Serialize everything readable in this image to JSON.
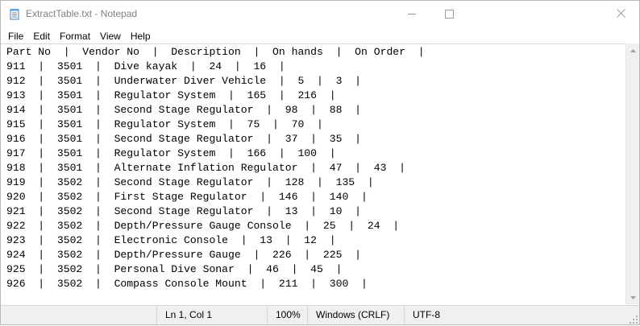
{
  "window": {
    "title": "ExtractTable.txt - Notepad",
    "icons": {
      "app": "notepad-icon",
      "minimize": "minimize-icon",
      "maximize": "maximize-icon",
      "close": "close-icon"
    }
  },
  "menu": {
    "items": [
      {
        "label": "File"
      },
      {
        "label": "Edit"
      },
      {
        "label": "Format"
      },
      {
        "label": "View"
      },
      {
        "label": "Help"
      }
    ]
  },
  "editor": {
    "lines": [
      "Part No  |  Vendor No  |  Description  |  On hands  |  On Order  |",
      "911  |  3501  |  Dive kayak  |  24  |  16  |",
      "912  |  3501  |  Underwater Diver Vehicle  |  5  |  3  |",
      "913  |  3501  |  Regulator System  |  165  |  216  |",
      "914  |  3501  |  Second Stage Regulator  |  98  |  88  |",
      "915  |  3501  |  Regulator System  |  75  |  70  |",
      "916  |  3501  |  Second Stage Regulator  |  37  |  35  |",
      "917  |  3501  |  Regulator System  |  166  |  100  |",
      "918  |  3501  |  Alternate Inflation Regulator  |  47  |  43  |",
      "919  |  3502  |  Second Stage Regulator  |  128  |  135  |",
      "920  |  3502  |  First Stage Regulator  |  146  |  140  |",
      "921  |  3502  |  Second Stage Regulator  |  13  |  10  |",
      "922  |  3502  |  Depth/Pressure Gauge Console  |  25  |  24  |",
      "923  |  3502  |  Electronic Console  |  13  |  12  |",
      "924  |  3502  |  Depth/Pressure Gauge  |  226  |  225  |",
      "925  |  3502  |  Personal Dive Sonar  |  46  |  45  |",
      "926  |  3502  |  Compass Console Mount  |  211  |  300  |"
    ]
  },
  "scrollbar": {
    "up_icon": "scroll-up-arrow-icon",
    "down_icon": "scroll-down-arrow-icon"
  },
  "status": {
    "position": "Ln 1, Col 1",
    "zoom": "100%",
    "line_ending": "Windows (CRLF)",
    "encoding": "UTF-8"
  }
}
